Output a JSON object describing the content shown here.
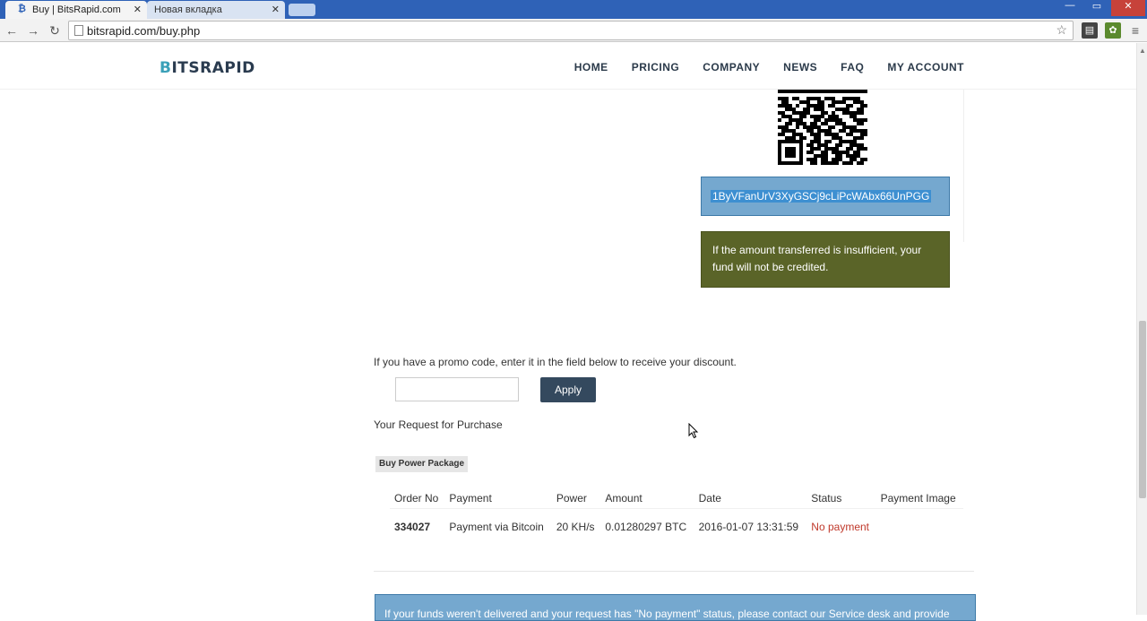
{
  "browser": {
    "tabs": [
      {
        "label": "Buy | BitsRapid.com",
        "active": true
      },
      {
        "label": "Новая вкладка",
        "active": false
      }
    ],
    "url": "bitsrapid.com/buy.php"
  },
  "site": {
    "logo_prefix": "B",
    "logo_rest": "ITSRAPID",
    "nav": [
      "HOME",
      "PRICING",
      "COMPANY",
      "NEWS",
      "FAQ",
      "MY ACCOUNT"
    ]
  },
  "payment": {
    "address": "1ByVFanUrV3XyGSCj9cLiPcWAbx66UnPGG",
    "warning": "If the amount transferred is insufficient, your fund will not be credited."
  },
  "promo": {
    "text": "If you have a promo code, enter it in the field below to receive your discount.",
    "input_value": "",
    "apply_label": "Apply"
  },
  "request": {
    "title": "Your Request for Purchase",
    "package_label": "Buy Power Package",
    "columns": [
      "Order No",
      "Payment",
      "Power",
      "Amount",
      "Date",
      "Status",
      "Payment Image"
    ],
    "rows": [
      {
        "order_no": "334027",
        "payment": "Payment via Bitcoin",
        "power": "20 KH/s",
        "amount": "0.01280297 BTC",
        "date": "2016-01-07 13:31:59",
        "status": "No payment",
        "image": ""
      }
    ]
  },
  "bottom_notice": "If your funds weren't delivered and your request has \"No payment\" status, please contact our Service desk and provide",
  "colors": {
    "nav_text": "#2b3a4a",
    "address_bg": "#75a8cf",
    "warning_bg": "#5a6428",
    "apply_bg": "#34495e",
    "status_red": "#c0392b"
  }
}
